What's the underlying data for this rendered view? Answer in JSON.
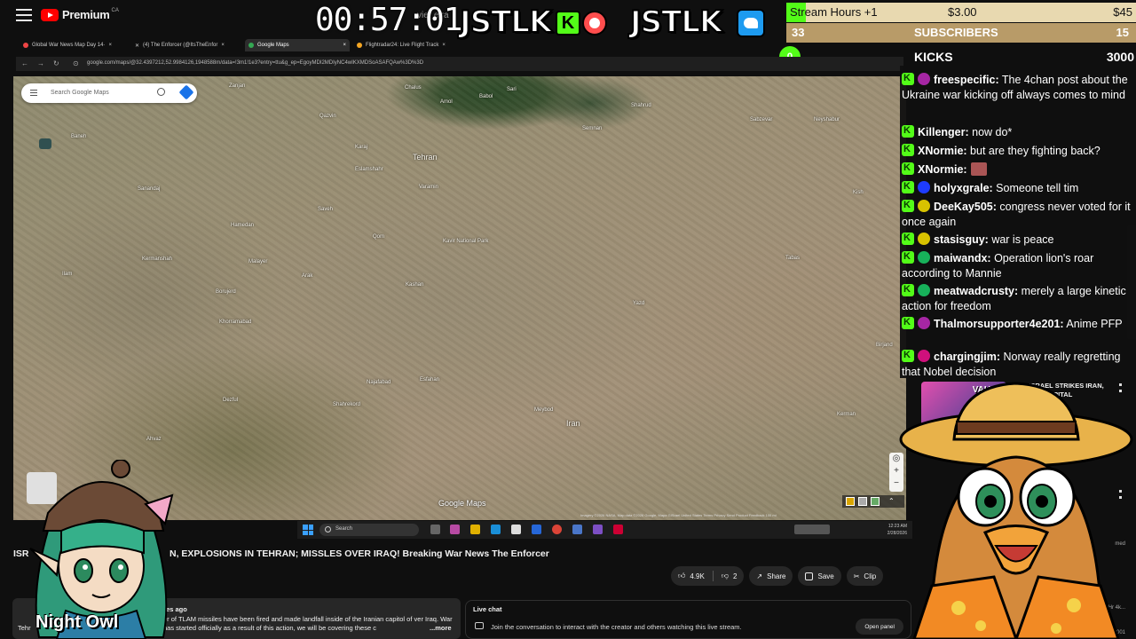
{
  "youtube": {
    "brand": "Premium",
    "brand_sup": "CA"
  },
  "overlay": {
    "timer": "00:57:01",
    "timer_ghost": "vier eira",
    "logo_text": "JSTLK",
    "kick_letter": "K",
    "stream_hours_label": "Stream Hours +1",
    "stream_hours_money": "$3.00",
    "stream_hours_goal": "$45",
    "subscribers_label": "SUBSCRIBERS",
    "subscribers_left": "33",
    "subscribers_right": "15",
    "kicks_label": "KICKS",
    "kicks_value": "3000",
    "zero_badge": "0"
  },
  "browser": {
    "tabs": [
      "Global War News Map Day 14·",
      "(4) The Enforcer (@ItsTheEnfor",
      "Google Maps",
      "Flightradar24: Live Flight Track"
    ],
    "url": "google.com/maps/@32.4397212,52.9984126,1948588m/data=!3m1!1e3?entry=ttu&g_ep=EgoyMDI2MDIyNC4wIKXMDSoASAFQAw%3D%3D"
  },
  "map": {
    "search_placeholder": "Search Google Maps",
    "brand": "Google Maps",
    "attribution": "Imagery ©2026 NASA, Map data ©2026 Google, Mapa GISrael  United States  Terms  Privacy  Send Product Feedback  100 mi",
    "zoom_in": "+",
    "zoom_out": "−",
    "cities": [
      {
        "name": "Tehran",
        "big": true
      },
      {
        "name": "Iran",
        "big": true
      },
      {
        "name": "Esfahan",
        "big": false
      },
      {
        "name": "Qom",
        "big": false
      },
      {
        "name": "Kashan",
        "big": false
      },
      {
        "name": "Karaj",
        "big": false
      },
      {
        "name": "Qazvin",
        "big": false
      },
      {
        "name": "Zanjan",
        "big": false
      },
      {
        "name": "Hamedan",
        "big": false
      },
      {
        "name": "Arak",
        "big": false
      },
      {
        "name": "Kermanshah",
        "big": false
      },
      {
        "name": "Malayer",
        "big": false
      },
      {
        "name": "Borujerd",
        "big": false
      },
      {
        "name": "Khorramabad",
        "big": false
      },
      {
        "name": "Dezful",
        "big": false
      },
      {
        "name": "Ahvaz",
        "big": false
      },
      {
        "name": "Najafabad",
        "big": false
      },
      {
        "name": "Shahrekord",
        "big": false
      },
      {
        "name": "Yazd",
        "big": false
      },
      {
        "name": "Sari",
        "big": false
      },
      {
        "name": "Amol",
        "big": false
      },
      {
        "name": "Babol",
        "big": false
      },
      {
        "name": "Semnan",
        "big": false
      },
      {
        "name": "Shahrud",
        "big": false
      },
      {
        "name": "Sabzevar",
        "big": false
      },
      {
        "name": "Neyshabur",
        "big": false
      },
      {
        "name": "Tabas",
        "big": false
      },
      {
        "name": "Kerman",
        "big": false
      },
      {
        "name": "Birjand",
        "big": false
      },
      {
        "name": "Varamin",
        "big": false
      },
      {
        "name": "Saveh",
        "big": false
      },
      {
        "name": "Eslamshahr",
        "big": false
      },
      {
        "name": "Baneh",
        "big": false
      },
      {
        "name": "Sanandaj",
        "big": false
      },
      {
        "name": "Ilam",
        "big": false
      },
      {
        "name": "Meybod",
        "big": false
      },
      {
        "name": "Kavir National Park",
        "big": false
      },
      {
        "name": "Chalus",
        "big": false
      },
      {
        "name": "Kish",
        "big": false
      }
    ]
  },
  "taskbar": {
    "search": "Search",
    "time": "12:23 AM",
    "date": "2/28/2026"
  },
  "video": {
    "title_prefix": "ISR",
    "title_suffix": "N, EXPLOSIONS IN TEHRAN; MISSLES OVER IRAQ! Breaking War News The Enforcer",
    "likes": "4.9K",
    "dislikes": "2",
    "share": "Share",
    "save": "Save",
    "clip": "Clip",
    "desc_meta": "utes ago",
    "desc_text": "er of TLAM missiles have been fired and made landfall inside of the Iranian capitol of ver Iraq. War has started officially as a result of this action, we will be covering these c",
    "desc_more": "...more",
    "desc_left_frag": "Tehr"
  },
  "live_chat": {
    "title": "Live chat",
    "text": "Join the conversation to interact with the creator and others watching this live stream.",
    "open": "Open panel"
  },
  "chat": [
    {
      "user": "freespecific:",
      "text": " The 4chan post about the Ukraine war kicking off always comes to mind",
      "dot": "#a626a4"
    },
    {
      "user": "Killenger:",
      "text": " now do*",
      "dot": ""
    },
    {
      "user": "XNormie:",
      "text": " but are they fighting back?",
      "dot": ""
    },
    {
      "user": "XNormie:",
      "text": "",
      "dot": "",
      "emote": true
    },
    {
      "user": "holyxgrale:",
      "text": " Someone tell tim",
      "dot": "#1e3cff"
    },
    {
      "user": "DeeKay505:",
      "text": " congress never voted for it once again",
      "dot": "#d8c200"
    },
    {
      "user": "stasisguy:",
      "text": " war is peace",
      "dot": "#d8c200"
    },
    {
      "user": "maiwandx:",
      "text": " Operation lion's roar according to Mannie",
      "dot": "#17b15a"
    },
    {
      "user": "meatwadcrusty:",
      "text": " merely a large kinetic action for freedom",
      "dot": "#17b15a"
    },
    {
      "user": "Thalmorsupporter4e201:",
      "text": " Anime PFP",
      "dot": "#a626a4"
    },
    {
      "user": "chargingjim:",
      "text": " Norway really regretting that Nobel decision",
      "dot": "#d0107c"
    }
  ],
  "recommended": {
    "title": "LIVE: ISRAEL STRIKES IRAN, BOMBING CAPITAL",
    "channel": "VAUSH",
    "frag1": "im",
    "frag2": "med",
    "frag3": "1Hr 4k...",
    "frag4": "1,0001"
  },
  "mascot": {
    "name": "Night Owl"
  }
}
